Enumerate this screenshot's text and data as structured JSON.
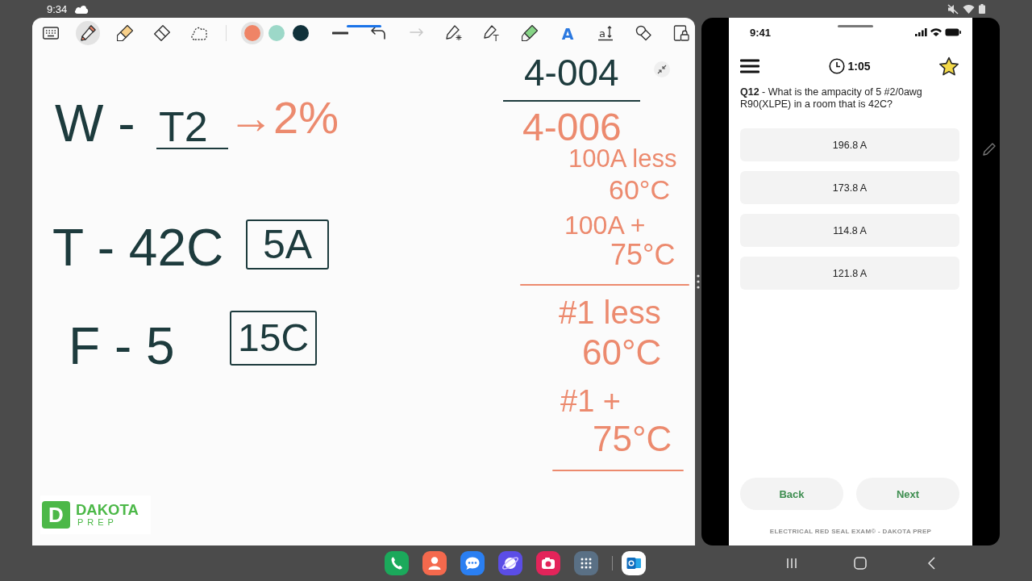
{
  "status_bar": {
    "time": "9:34"
  },
  "notes_app": {
    "tools": [
      {
        "kind": "keyboard",
        "selected": false
      },
      {
        "kind": "pen",
        "selected": true
      },
      {
        "kind": "highlighter",
        "selected": false
      },
      {
        "kind": "eraser",
        "selected": false
      },
      {
        "kind": "lasso",
        "selected": false
      }
    ],
    "pen_colors": [
      {
        "color": "#ef8466",
        "selected": true
      },
      {
        "color": "#9cd8c8",
        "selected": false
      },
      {
        "color": "#10313a",
        "selected": false
      }
    ],
    "actions": [
      {
        "kind": "stroke_width",
        "disabled": false
      },
      {
        "kind": "undo",
        "disabled": false
      },
      {
        "kind": "redo",
        "disabled": true
      },
      {
        "kind": "shape_pen",
        "disabled": false
      },
      {
        "kind": "text_pen",
        "glyph": "T",
        "disabled": false
      },
      {
        "kind": "magic_pen",
        "disabled": false
      },
      {
        "kind": "text_style",
        "glyph": "A",
        "disabled": false
      },
      {
        "kind": "text_size",
        "glyph": "a",
        "disabled": false
      },
      {
        "kind": "shapes",
        "disabled": false
      },
      {
        "kind": "lock",
        "disabled": false
      }
    ],
    "ink": [
      {
        "kind": "text",
        "text": "W -",
        "color": "#1d3b3d"
      },
      {
        "kind": "underlined",
        "text": "T2",
        "color": "#1d3b3d"
      },
      {
        "kind": "text",
        "text": "→2%",
        "color": "#ec8a6e"
      },
      {
        "kind": "text",
        "text": "T - 42C",
        "color": "#1d3b3d"
      },
      {
        "kind": "boxed",
        "text": "5A",
        "color": "#1d3b3d"
      },
      {
        "kind": "text",
        "text": "F - 5",
        "color": "#1d3b3d"
      },
      {
        "kind": "boxed",
        "text": "15C",
        "color": "#1d3b3d"
      },
      {
        "kind": "underlined",
        "text": "4-004",
        "color": "#1d3b3d"
      },
      {
        "kind": "text",
        "text": "4-006",
        "color": "#ec8a6e"
      },
      {
        "kind": "text",
        "text": "100A less",
        "color": "#ec8a6e"
      },
      {
        "kind": "text",
        "text": "60°C",
        "color": "#ec8a6e"
      },
      {
        "kind": "text",
        "text": "100A +",
        "color": "#ec8a6e"
      },
      {
        "kind": "text",
        "text": "75°C",
        "color": "#ec8a6e"
      },
      {
        "kind": "rule",
        "color": "#ec8a6e"
      },
      {
        "kind": "text",
        "text": "#1 less",
        "color": "#ec8a6e"
      },
      {
        "kind": "text",
        "text": "60°C",
        "color": "#ec8a6e"
      },
      {
        "kind": "text",
        "text": "#1 +",
        "color": "#ec8a6e"
      },
      {
        "kind": "text",
        "text": "75°C",
        "color": "#ec8a6e"
      },
      {
        "kind": "rule",
        "color": "#ec8a6e"
      }
    ]
  },
  "logo": {
    "mark": "D",
    "name": "DAKOTA",
    "tagline": "PREP"
  },
  "phone": {
    "time": "9:41",
    "timer": "1:05",
    "starred": true,
    "question": "**Q12** - What is the ampacity of 5 #2/0awg R90(XLPE) in a room that is 42C?",
    "options": [
      {
        "label": "196.8 A",
        "selected": false
      },
      {
        "label": "173.8 A",
        "selected": false
      },
      {
        "label": "114.8 A",
        "selected": false
      },
      {
        "label": "121.8 A",
        "selected": false
      }
    ],
    "buttons": [
      "Back",
      "Next"
    ],
    "footer": "ELECTRICAL RED SEAL EXAM© - DAKOTA PREP"
  },
  "taskbar": {
    "apps": [
      {
        "kind": "phone"
      },
      {
        "kind": "contacts"
      },
      {
        "kind": "messages"
      },
      {
        "kind": "browser"
      },
      {
        "kind": "camera"
      },
      {
        "kind": "app_drawer"
      }
    ],
    "recent_apps": [
      {
        "kind": "mail"
      }
    ]
  }
}
